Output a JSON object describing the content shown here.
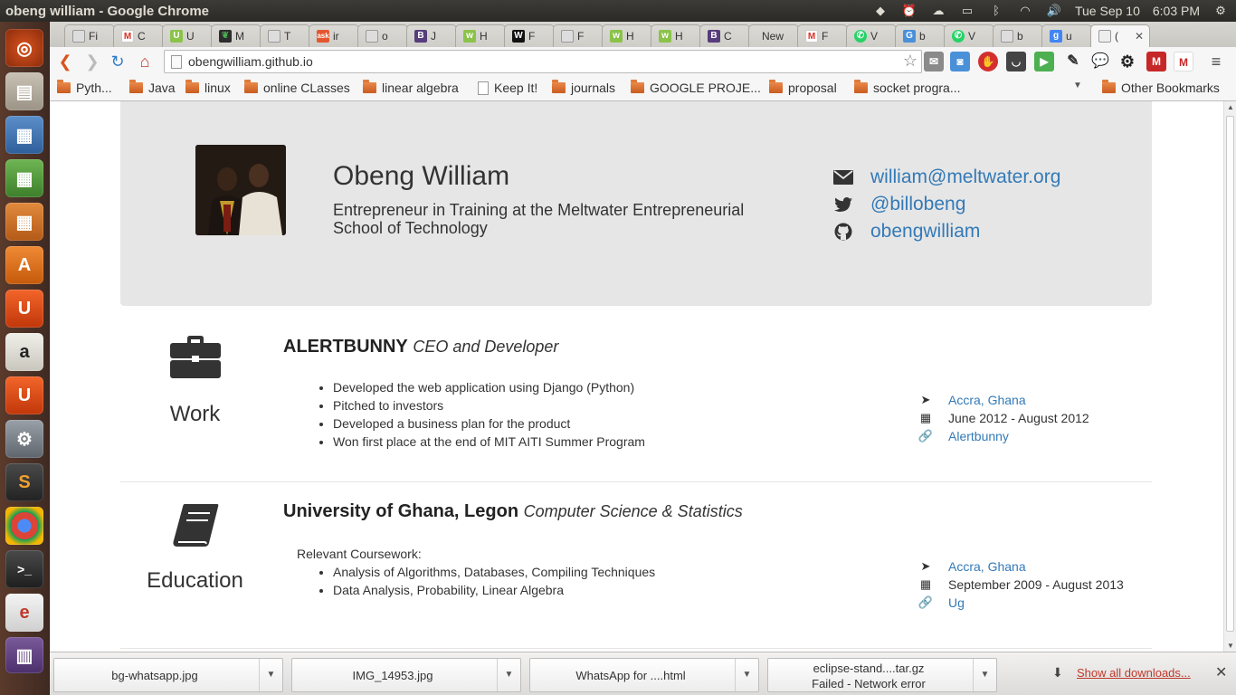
{
  "system": {
    "window_title": "obeng william - Google Chrome",
    "date": "Tue Sep 10",
    "time": "6:03 PM"
  },
  "tabs": [
    {
      "label": "Fi"
    },
    {
      "label": "C"
    },
    {
      "label": "U"
    },
    {
      "label": "M"
    },
    {
      "label": "T"
    },
    {
      "label": "ir"
    },
    {
      "label": "o"
    },
    {
      "label": "J"
    },
    {
      "label": "H"
    },
    {
      "label": "F"
    },
    {
      "label": "F"
    },
    {
      "label": "H"
    },
    {
      "label": "H"
    },
    {
      "label": "C"
    },
    {
      "label": "New"
    },
    {
      "label": "F"
    },
    {
      "label": "V"
    },
    {
      "label": "b"
    },
    {
      "label": "V"
    },
    {
      "label": "b"
    },
    {
      "label": "u"
    },
    {
      "label": "("
    }
  ],
  "toolbar": {
    "url": "obengwilliam.github.io"
  },
  "bookmarks": [
    {
      "label": "Pyth..."
    },
    {
      "label": "Java"
    },
    {
      "label": "linux"
    },
    {
      "label": "online CLasses"
    },
    {
      "label": "linear algebra"
    },
    {
      "label": "Keep It!"
    },
    {
      "label": "journals"
    },
    {
      "label": "GOOGLE PROJE..."
    },
    {
      "label": "proposal"
    },
    {
      "label": "socket progra..."
    }
  ],
  "other_bookmarks": "Other Bookmarks",
  "profile": {
    "name": "Obeng William",
    "tagline": "Entrepreneur in Training at the Meltwater Entrepreneurial School of Technology",
    "email": "william@meltwater.org",
    "twitter": "@billobeng",
    "github": "obengwilliam"
  },
  "work": {
    "label": "Work",
    "org": "ALERTBUNNY",
    "role": "CEO and Developer",
    "items": [
      "Developed the web application using Django (Python)",
      "Pitched to investors",
      "Developed a business plan for the product",
      "Won first place at the end of MIT AITI Summer Program"
    ],
    "location": "Accra, Ghana",
    "dates": "June 2012 - August 2012",
    "link": "Alertbunny"
  },
  "education": {
    "label": "Education",
    "org": "University of Ghana, Legon",
    "role": "Computer Science & Statistics",
    "coursework_label": "Relevant Coursework:",
    "items": [
      "Analysis of Algorithms, Databases, Compiling Techniques",
      "Data Analysis, Probability, Linear Algebra"
    ],
    "location": "Accra, Ghana",
    "dates": "September 2009 - August 2013",
    "link": "Ug"
  },
  "downloads": {
    "items": [
      {
        "name": "bg-whatsapp.jpg"
      },
      {
        "name": "IMG_14953.jpg"
      },
      {
        "name": "WhatsApp for ....html"
      },
      {
        "name": "eclipse-stand....tar.gz",
        "status": "Failed - Network error"
      }
    ],
    "show_all": "Show all downloads..."
  }
}
